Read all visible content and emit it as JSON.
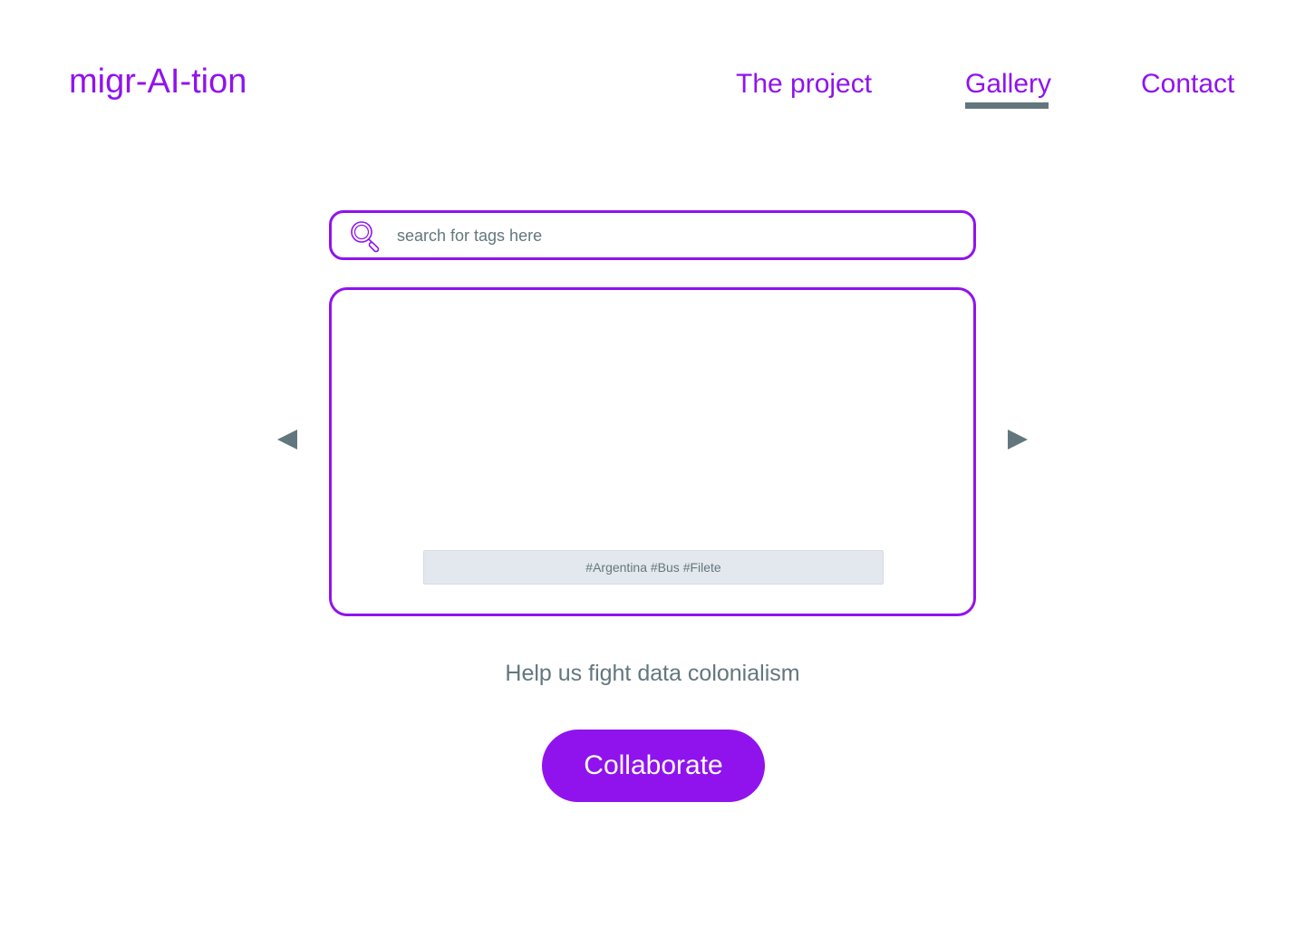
{
  "header": {
    "brand": "migr-AI-tion",
    "nav": [
      {
        "label": "The project",
        "active": false
      },
      {
        "label": "Gallery",
        "active": true
      },
      {
        "label": "Contact",
        "active": false
      }
    ]
  },
  "search": {
    "placeholder": "search for tags here",
    "value": "",
    "icon": "magnifying-glass-icon"
  },
  "gallery": {
    "tags": "#Argentina #Bus #Filete",
    "prev_icon": "triangle-left-icon",
    "next_icon": "triangle-right-icon"
  },
  "cta": {
    "tagline": "Help us fight data colonialism",
    "button_label": "Collaborate"
  },
  "colors": {
    "accent": "#9013ee",
    "muted": "#62777d",
    "tag_background": "#e3e8ee"
  }
}
